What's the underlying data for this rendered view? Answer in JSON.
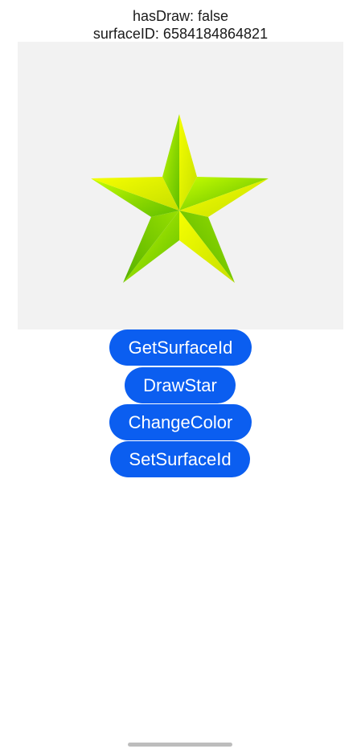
{
  "status": {
    "has_draw": "hasDraw: false",
    "surface_id": "surfaceID: 6584184864821"
  },
  "canvas": {
    "background_color": "#f2f2f2",
    "shape": "five-point-star",
    "star_colors": [
      "#66d400",
      "#d7ff00",
      "#f5ef00",
      "#8ed000"
    ]
  },
  "buttons": {
    "get_surface_id": "GetSurfaceId",
    "draw_star": "DrawStar",
    "change_color": "ChangeColor",
    "set_surface_id": "SetSurfaceId",
    "color": "#0b5ef0"
  }
}
